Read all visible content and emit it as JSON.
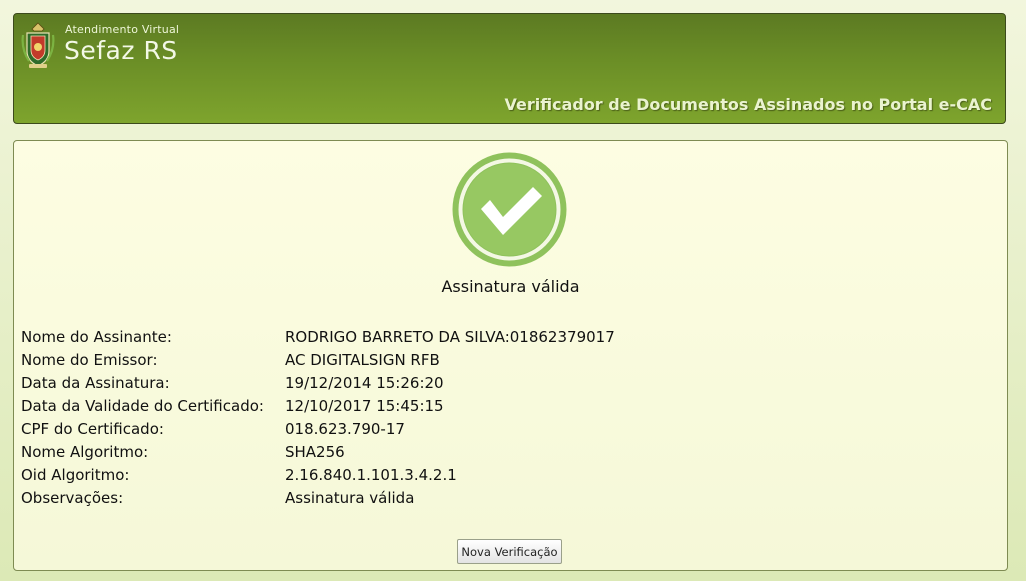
{
  "header": {
    "brand_small": "Atendimento Virtual",
    "brand_big": "Sefaz RS",
    "subtitle": "Verificador de Documentos Assinados no Portal e-CAC"
  },
  "status": {
    "title": "Assinatura válida",
    "icon": "check-circle-icon",
    "color": "#8fc25c"
  },
  "details": [
    {
      "label": "Nome do Assinante:",
      "value": "RODRIGO BARRETO DA SILVA:01862379017"
    },
    {
      "label": "Nome do Emissor:",
      "value": "AC DIGITALSIGN RFB"
    },
    {
      "label": "Data da Assinatura:",
      "value": "19/12/2014 15:26:20"
    },
    {
      "label": "Data da Validade do Certificado:",
      "value": "12/10/2017 15:45:15"
    },
    {
      "label": "CPF do Certificado:",
      "value": "018.623.790-17"
    },
    {
      "label": "Nome Algoritmo:",
      "value": "SHA256"
    },
    {
      "label": "Oid Algoritmo:",
      "value": "2.16.840.1.101.3.4.2.1"
    },
    {
      "label": "Observações:",
      "value": "Assinatura válida"
    }
  ],
  "actions": {
    "new_check_label": "Nova Verificação"
  }
}
